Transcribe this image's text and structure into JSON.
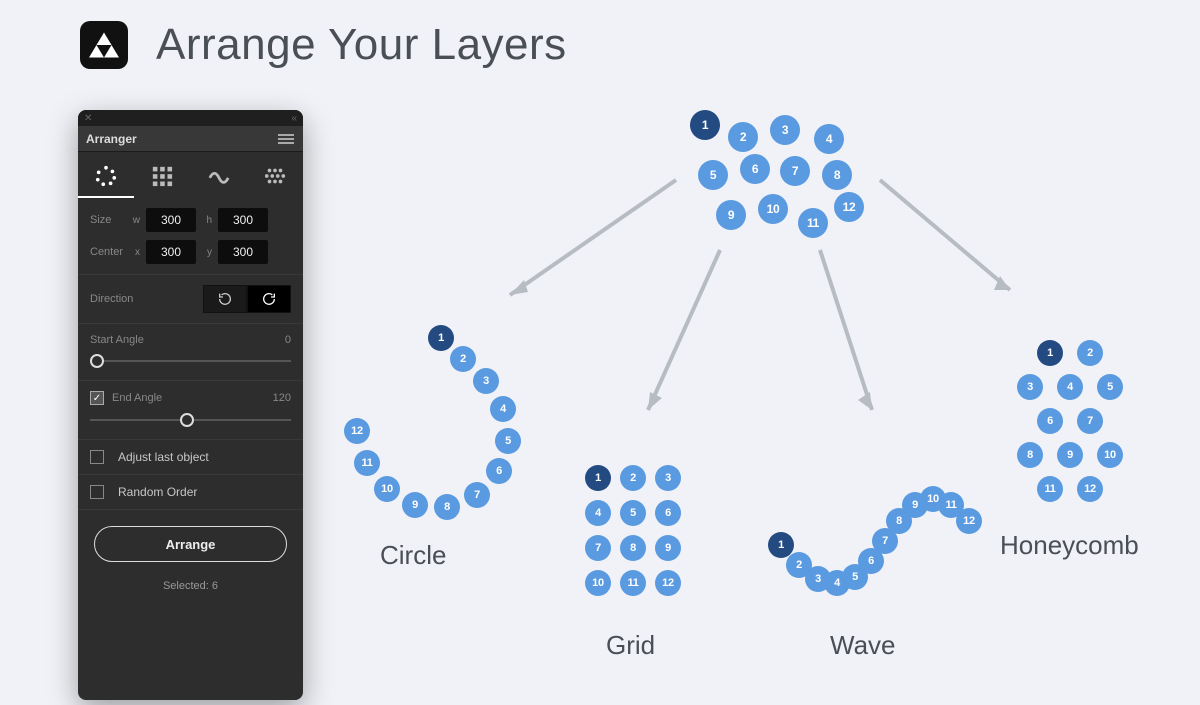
{
  "title": "Arrange Your Layers",
  "panel": {
    "name": "Arranger",
    "modes": [
      "circle",
      "grid",
      "wave",
      "honeycomb"
    ],
    "active_mode": "circle",
    "size": {
      "label": "Size",
      "w_label": "w",
      "w": "300",
      "h_label": "h",
      "h": "300"
    },
    "center": {
      "label": "Center",
      "x_label": "x",
      "x": "300",
      "y_label": "y",
      "y": "300"
    },
    "direction": {
      "label": "Direction",
      "active": "cw"
    },
    "start_angle": {
      "label": "Start Angle",
      "value": "0",
      "pos": 0
    },
    "end_angle": {
      "label": "End Angle",
      "value": "120",
      "checked": true,
      "pos": 45
    },
    "adjust_last": {
      "label": "Adjust last object",
      "checked": false
    },
    "random_order": {
      "label": "Random Order",
      "checked": false
    },
    "arrange_label": "Arrange",
    "selected_label": "Selected: 6"
  },
  "layouts": {
    "source": {
      "items": [
        "1",
        "2",
        "3",
        "4",
        "5",
        "6",
        "7",
        "8",
        "9",
        "10",
        "11",
        "12"
      ]
    },
    "circle": {
      "title": "Circle",
      "items": [
        "1",
        "2",
        "3",
        "4",
        "5",
        "6",
        "7",
        "8",
        "9",
        "10",
        "11",
        "12"
      ]
    },
    "grid": {
      "title": "Grid",
      "items": [
        "1",
        "2",
        "3",
        "4",
        "5",
        "6",
        "7",
        "8",
        "9",
        "10",
        "11",
        "12"
      ]
    },
    "wave": {
      "title": "Wave",
      "items": [
        "1",
        "2",
        "3",
        "4",
        "5",
        "6",
        "7",
        "8",
        "9",
        "10",
        "11",
        "12"
      ]
    },
    "honeycomb": {
      "title": "Honeycomb",
      "items": [
        "1",
        "2",
        "3",
        "4",
        "5",
        "6",
        "7",
        "8",
        "9",
        "10",
        "11",
        "12"
      ]
    }
  }
}
